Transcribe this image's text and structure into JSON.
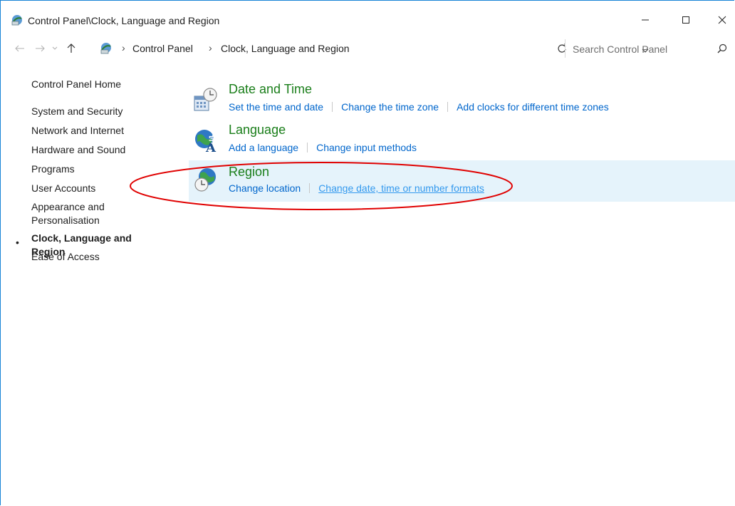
{
  "window": {
    "title": "Control Panel\\Clock, Language and Region",
    "minimize_glyph": "—",
    "maximize_glyph": "☐",
    "close_glyph": "✕"
  },
  "address": {
    "separator": "›",
    "breadcrumbs": [
      "Control Panel",
      "Clock, Language and Region"
    ],
    "search_placeholder": "Search Control Panel"
  },
  "sidebar": {
    "items": [
      {
        "label": "Control Panel Home"
      },
      {
        "label": "System and Security"
      },
      {
        "label": "Network and Internet"
      },
      {
        "label": "Hardware and Sound"
      },
      {
        "label": "Programs"
      },
      {
        "label": "User Accounts"
      },
      {
        "label": "Appearance and Personalisation"
      },
      {
        "label": "Clock, Language and Region",
        "active": true
      },
      {
        "label": "Ease of Access"
      }
    ],
    "bullet": "•"
  },
  "categories": [
    {
      "title": "Date and Time",
      "icon": "date-time-icon",
      "links": [
        "Set the time and date",
        "Change the time zone",
        "Add clocks for different time zones"
      ]
    },
    {
      "title": "Language",
      "icon": "language-icon",
      "links": [
        "Add a language",
        "Change input methods"
      ]
    },
    {
      "title": "Region",
      "icon": "region-icon",
      "links": [
        "Change location",
        "Change date, time or number formats"
      ],
      "highlighted": true
    }
  ],
  "colors": {
    "category_title": "#1a7e1a",
    "link": "#0066cc",
    "highlight_bg": "#e5f3fb",
    "annotation": "#e00000"
  }
}
